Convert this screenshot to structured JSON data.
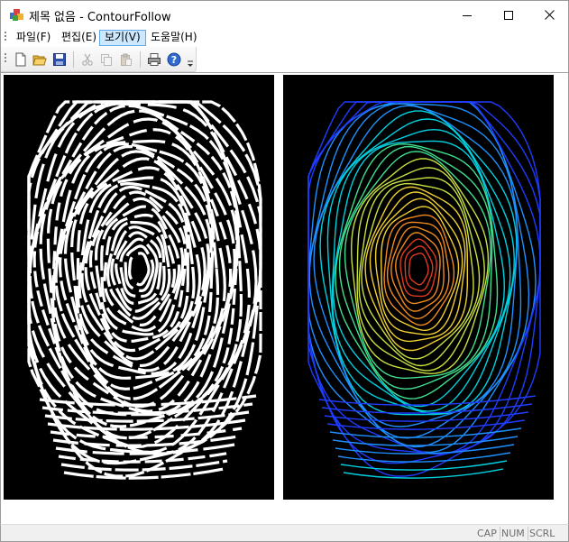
{
  "window": {
    "title": "제목 없음 - ContourFollow",
    "buttons": {
      "minimize": "minimize-icon",
      "maximize": "maximize-icon",
      "close": "close-icon"
    }
  },
  "menu": {
    "items": [
      {
        "label": "파일(F)",
        "active": false
      },
      {
        "label": "편집(E)",
        "active": false
      },
      {
        "label": "보기(V)",
        "active": true
      },
      {
        "label": "도움말(H)",
        "active": false
      }
    ]
  },
  "toolbar": {
    "buttons": [
      {
        "icon": "new-document-icon",
        "enabled": true
      },
      {
        "icon": "open-folder-icon",
        "enabled": true
      },
      {
        "icon": "save-disk-icon",
        "enabled": true
      },
      {
        "icon": "cut-icon",
        "enabled": false
      },
      {
        "icon": "copy-icon",
        "enabled": false
      },
      {
        "icon": "paste-icon",
        "enabled": false
      },
      {
        "icon": "print-icon",
        "enabled": true
      },
      {
        "icon": "help-icon",
        "enabled": true
      }
    ]
  },
  "views": {
    "left": {
      "content": "binary fingerprint ridge image",
      "colors": {
        "background": "#000000",
        "ridge": "#ffffff"
      }
    },
    "right": {
      "content": "colored contour-following result",
      "colors": {
        "background": "#000000",
        "palette": [
          "#1f3cff",
          "#1e90ff",
          "#00d0e0",
          "#40e090",
          "#c8e040",
          "#f0d030",
          "#f08a20",
          "#e03a20"
        ]
      }
    }
  },
  "statusbar": {
    "indicators": [
      "CAP",
      "NUM",
      "SCRL"
    ]
  }
}
